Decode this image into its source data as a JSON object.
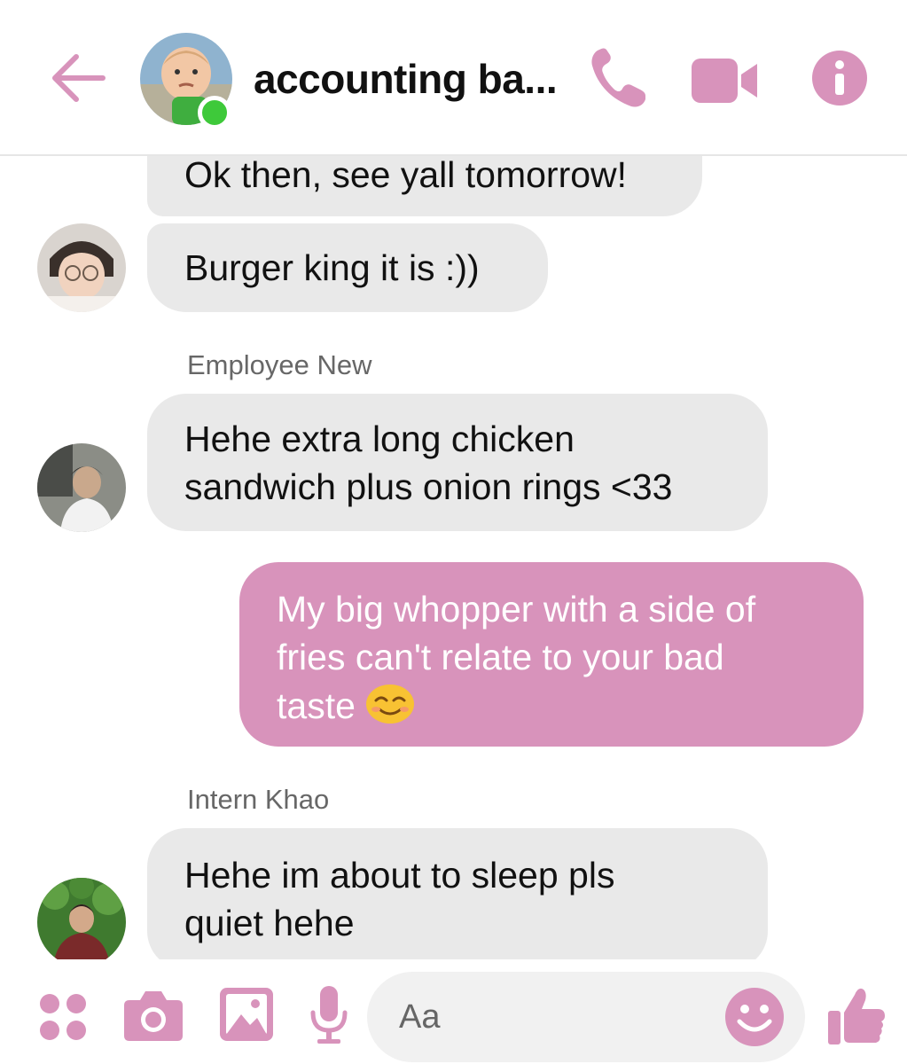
{
  "header": {
    "title": "accounting ba...",
    "icons": [
      "back-arrow-icon",
      "phone-icon",
      "video-camera-icon",
      "info-icon"
    ]
  },
  "messages": [
    {
      "text": "Ok then, see yall tomorrow!",
      "direction": "incoming"
    },
    {
      "text": "Burger king it is :))",
      "direction": "incoming"
    },
    {
      "sender": "Employee New",
      "text_lines": [
        "Hehe extra long chicken",
        "sandwich plus onion rings <33"
      ],
      "direction": "incoming"
    },
    {
      "text_lines": [
        "My big whopper with a side of",
        "fries can't relate to your bad",
        "taste"
      ],
      "emoji": "smiling-face-emoji",
      "direction": "outgoing"
    },
    {
      "sender": "Intern Khao",
      "text_lines": [
        "Hehe im about to sleep pls",
        "quiet hehe"
      ],
      "direction": "incoming"
    }
  ],
  "composer": {
    "placeholder": "Aa",
    "icons": [
      "apps-icon",
      "camera-icon",
      "gallery-icon",
      "microphone-icon",
      "emoji-icon",
      "thumbs-up-icon"
    ]
  },
  "colors": {
    "accent": "#d893bb",
    "incoming_bubble": "#e9e9e9",
    "online": "#3ec93a"
  }
}
